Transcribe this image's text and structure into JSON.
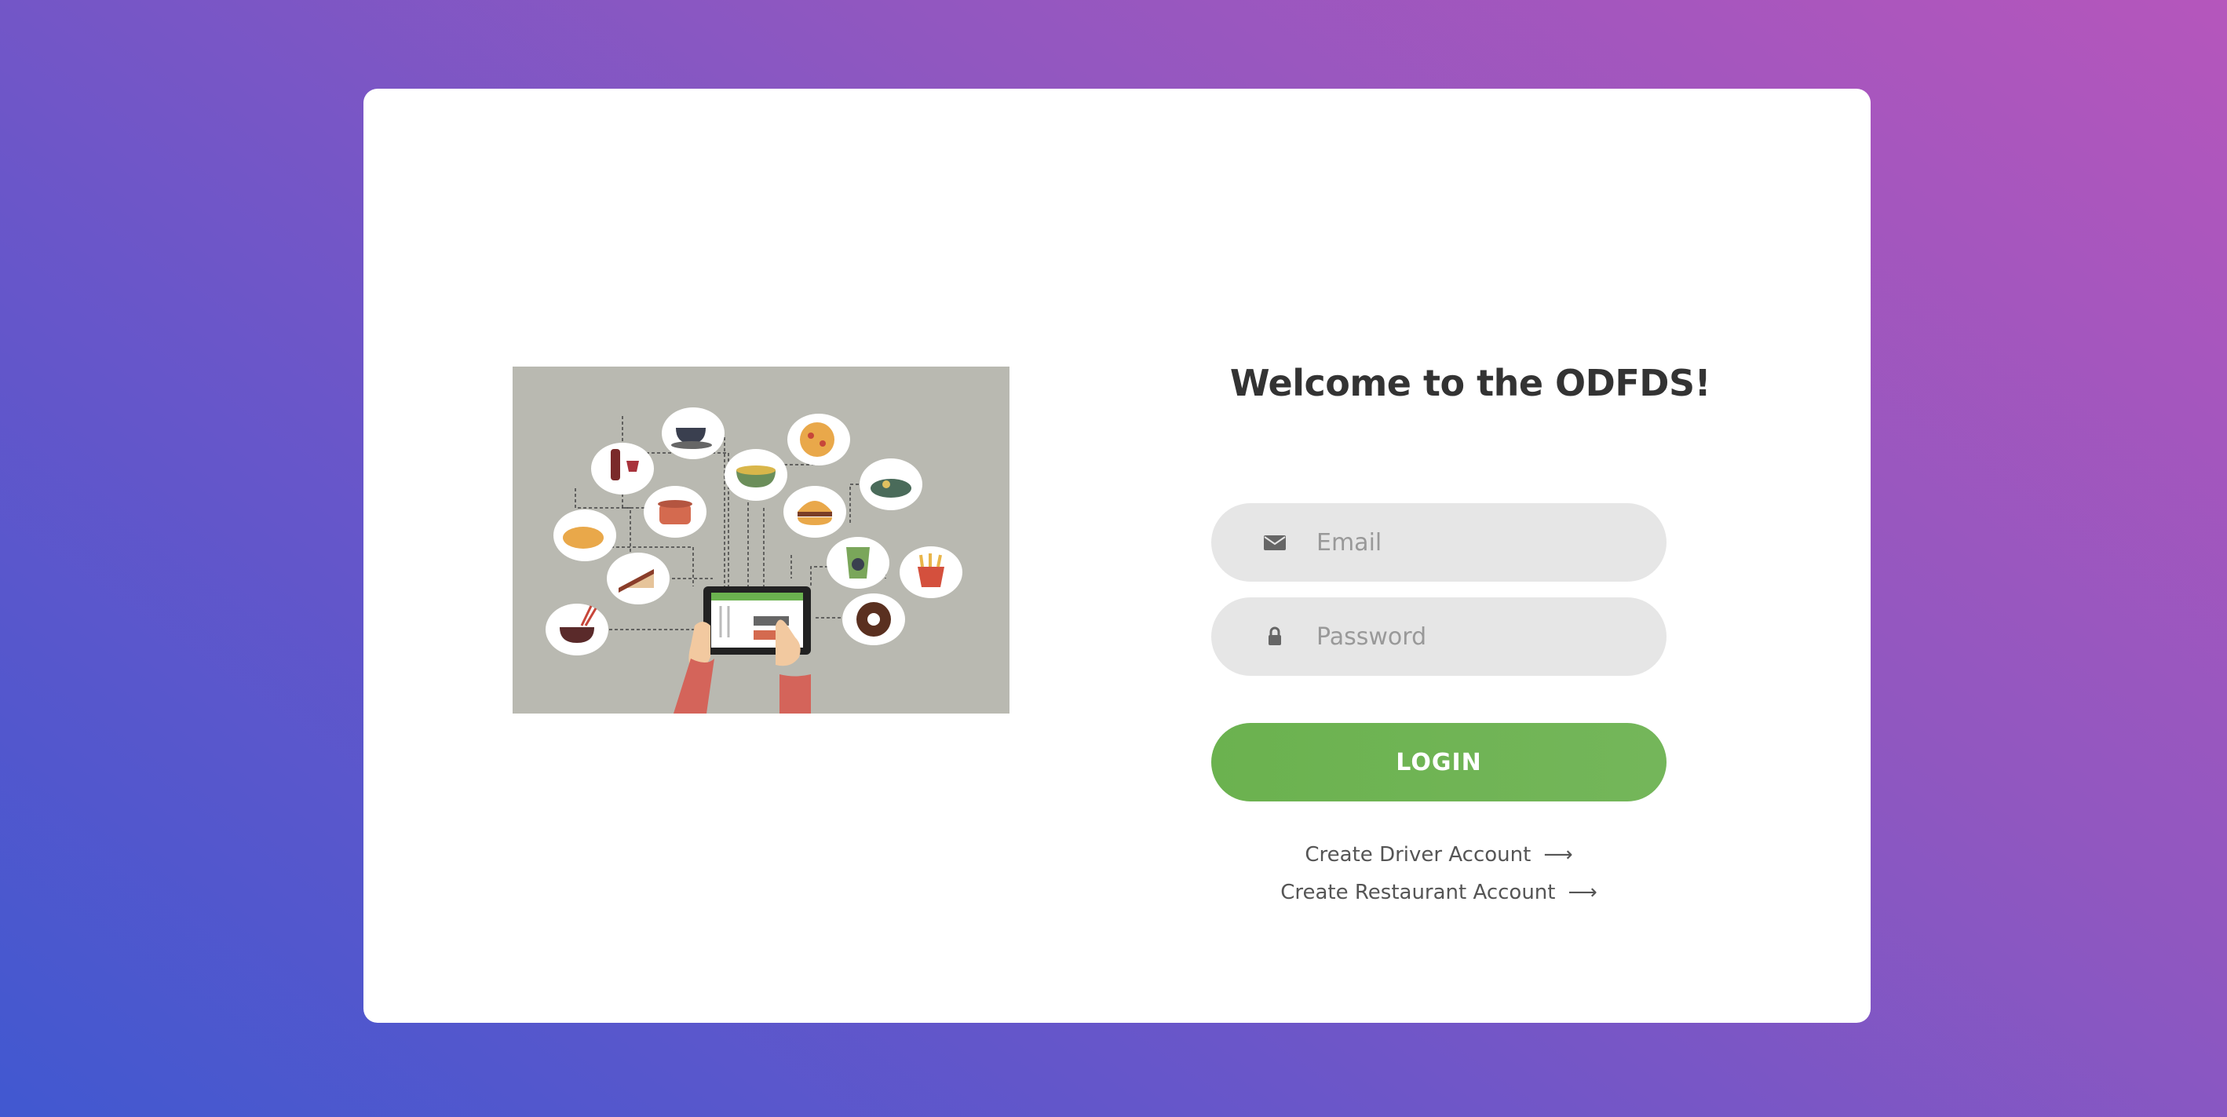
{
  "page": {
    "background_colors": [
      "#4158d0",
      "#6a56c9",
      "#9157c0",
      "#b556bc"
    ],
    "card_color": "#ffffff"
  },
  "illustration": {
    "description_icon": "food-ordering-tablet-illustration",
    "bg_color": "#b9b9b1"
  },
  "login": {
    "title": "Welcome to the ODFDS!",
    "email": {
      "placeholder": "Email",
      "value": "",
      "icon": "envelope-icon"
    },
    "password": {
      "placeholder": "Password",
      "value": "",
      "icon": "lock-icon"
    },
    "login_button_label": "LOGIN",
    "login_button_color": "#6bb24f",
    "links": [
      {
        "label": "Create Driver Account",
        "icon": "arrow-right-icon",
        "arrow": "⟶"
      },
      {
        "label": "Create Restaurant Account",
        "icon": "arrow-right-icon",
        "arrow": "⟶"
      }
    ]
  }
}
